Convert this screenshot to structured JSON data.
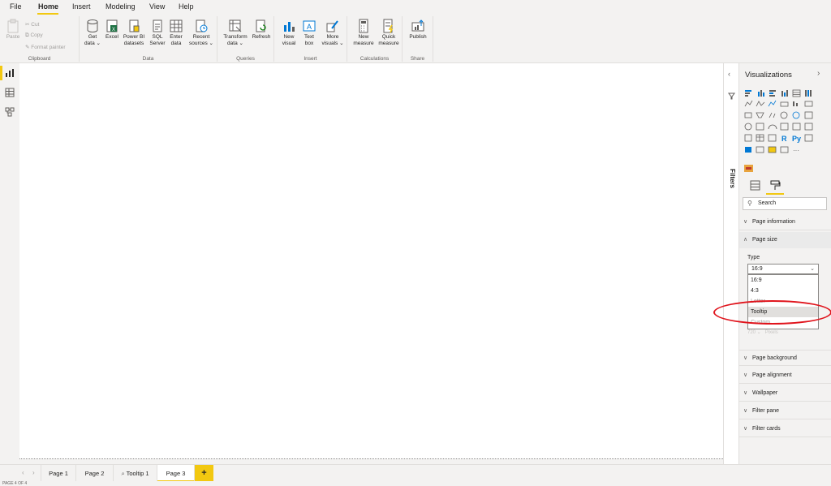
{
  "menu": {
    "file": "File",
    "home": "Home",
    "insert": "Insert",
    "modeling": "Modeling",
    "view": "View",
    "help": "Help"
  },
  "ribbon": {
    "clipboard": {
      "paste": "Paste",
      "cut": "Cut",
      "copy": "Copy",
      "format_painter": "Format painter",
      "label": "Clipboard"
    },
    "data": {
      "get_data": [
        "Get",
        "data ⌄"
      ],
      "excel": "Excel",
      "pbi_datasets": [
        "Power BI",
        "datasets"
      ],
      "sql": [
        "SQL",
        "Server"
      ],
      "enter_data": [
        "Enter",
        "data"
      ],
      "recent": [
        "Recent",
        "sources ⌄"
      ],
      "label": "Data"
    },
    "queries": {
      "transform": [
        "Transform",
        "data ⌄"
      ],
      "refresh": "Refresh",
      "label": "Queries"
    },
    "insert": {
      "new_visual": [
        "New",
        "visual"
      ],
      "text_box": [
        "Text",
        "box"
      ],
      "more_visuals": [
        "More",
        "visuals ⌄"
      ],
      "label": "Insert"
    },
    "calculations": {
      "new_measure": [
        "New",
        "measure"
      ],
      "quick_measure": [
        "Quick",
        "measure"
      ],
      "label": "Calculations"
    },
    "share": {
      "publish": "Publish",
      "label": "Share"
    }
  },
  "filters": {
    "label": "Filters"
  },
  "visualizations": {
    "title": "Visualizations",
    "search_placeholder": "Search",
    "sections": {
      "page_information": "Page information",
      "page_size": "Page size",
      "page_background": "Page background",
      "page_alignment": "Page alignment",
      "wallpaper": "Wallpaper",
      "filter_pane": "Filter pane",
      "filter_cards": "Filter cards"
    },
    "type_label": "Type",
    "type_value": "16:9",
    "type_options": [
      "16:9",
      "4:3",
      "Letter",
      "Tooltip",
      "Custom"
    ],
    "highlighted_option": "Tooltip",
    "ghost_values": [
      "720",
      "Pixels"
    ]
  },
  "pages": [
    "Page 1",
    "Page 2",
    "Tooltip 1",
    "Page 3"
  ],
  "active_page": "Page 3",
  "add_page": "+",
  "status": "PAGE 4 OF 4",
  "colors": {
    "accent": "#f2c811",
    "annotation": "#e0141c",
    "canvas": "#ffffff",
    "chrome": "#f3f2f1"
  }
}
